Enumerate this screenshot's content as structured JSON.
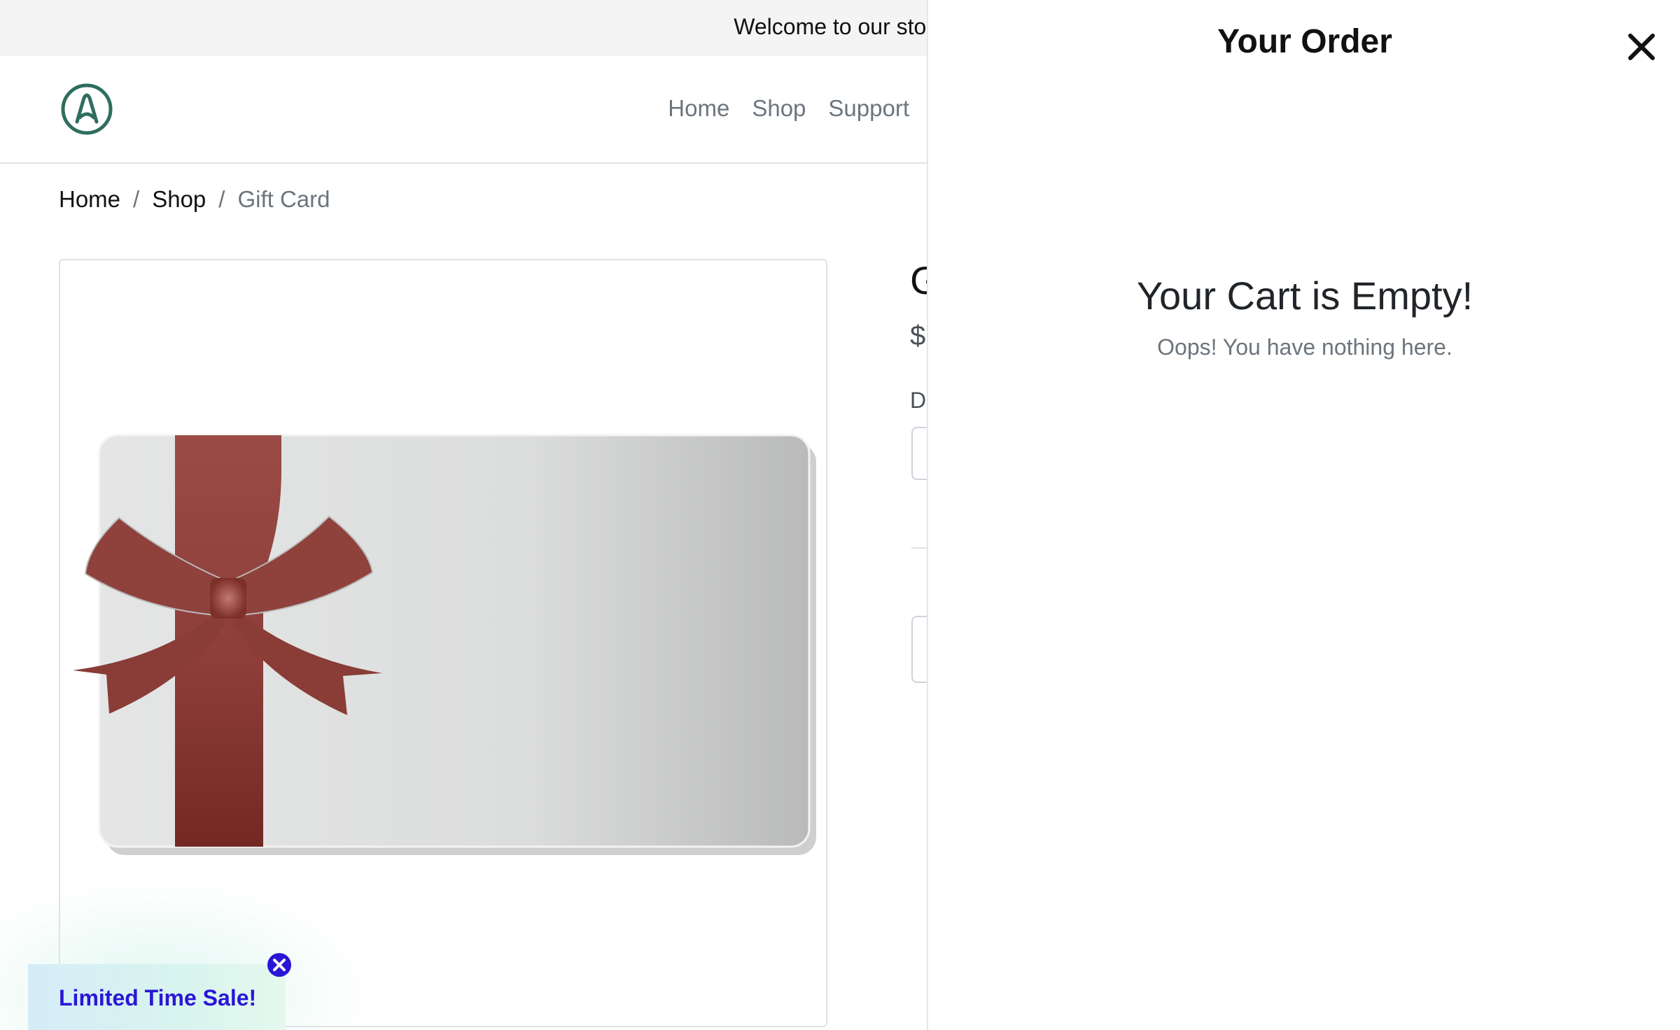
{
  "announcement": {
    "text": "Welcome to our store"
  },
  "header": {
    "logo_icon": "a-letter-circle-logo",
    "nav": [
      {
        "label": "Home"
      },
      {
        "label": "Shop"
      },
      {
        "label": "Support"
      }
    ]
  },
  "breadcrumb": {
    "items": [
      {
        "label": "Home"
      },
      {
        "label": "Shop"
      },
      {
        "label": "Gift Card"
      }
    ],
    "separator": "/"
  },
  "product": {
    "title": "G",
    "price": "$",
    "field_label": "D",
    "image_alt": "gift-card-with-red-ribbon"
  },
  "sale_banner": {
    "text": "Limited Time Sale!",
    "close_icon": "close-circle-icon"
  },
  "cart_drawer": {
    "title": "Your Order",
    "close_icon": "close-icon",
    "empty_title": "Your Cart is Empty!",
    "empty_message": "Oops! You have nothing here."
  },
  "colors": {
    "logo": "#2e6e5f",
    "sale_text": "#2a16d6",
    "ribbon": "#954641",
    "nav_text": "#6c757d"
  }
}
